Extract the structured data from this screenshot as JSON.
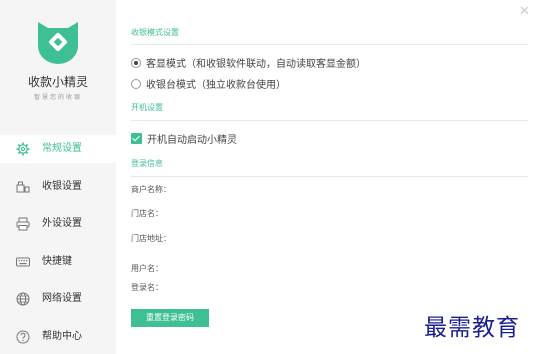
{
  "app": {
    "name": "收款小精灵",
    "slogan": "智慧您的收银",
    "accent_color": "#3fbf96",
    "close_icon": "close-icon"
  },
  "sidebar": {
    "items": [
      {
        "label": "常规设置",
        "icon": "gear-icon",
        "active": true
      },
      {
        "label": "收银设置",
        "icon": "register-icon",
        "active": false
      },
      {
        "label": "外设设置",
        "icon": "printer-icon",
        "active": false
      },
      {
        "label": "快捷键",
        "icon": "keyboard-icon",
        "active": false
      },
      {
        "label": "网络设置",
        "icon": "globe-icon",
        "active": false
      },
      {
        "label": "帮助中心",
        "icon": "help-icon",
        "active": false
      }
    ]
  },
  "sections": {
    "mode": {
      "title": "收银模式设置",
      "options": [
        {
          "label": "客显模式（和收银软件联动，自动读取客显金额）",
          "selected": true
        },
        {
          "label": "收银台模式（独立收款台使用）",
          "selected": false
        }
      ]
    },
    "startup": {
      "title": "开机设置",
      "checkbox_label": "开机自动启动小精灵",
      "checked": true
    },
    "login": {
      "title": "登录信息",
      "fields": [
        "商户名称：",
        "门店名：",
        "门店地址：",
        "用户名：",
        "登录名："
      ],
      "reset_button": "重置登录密码"
    }
  },
  "watermark": "最需教育"
}
